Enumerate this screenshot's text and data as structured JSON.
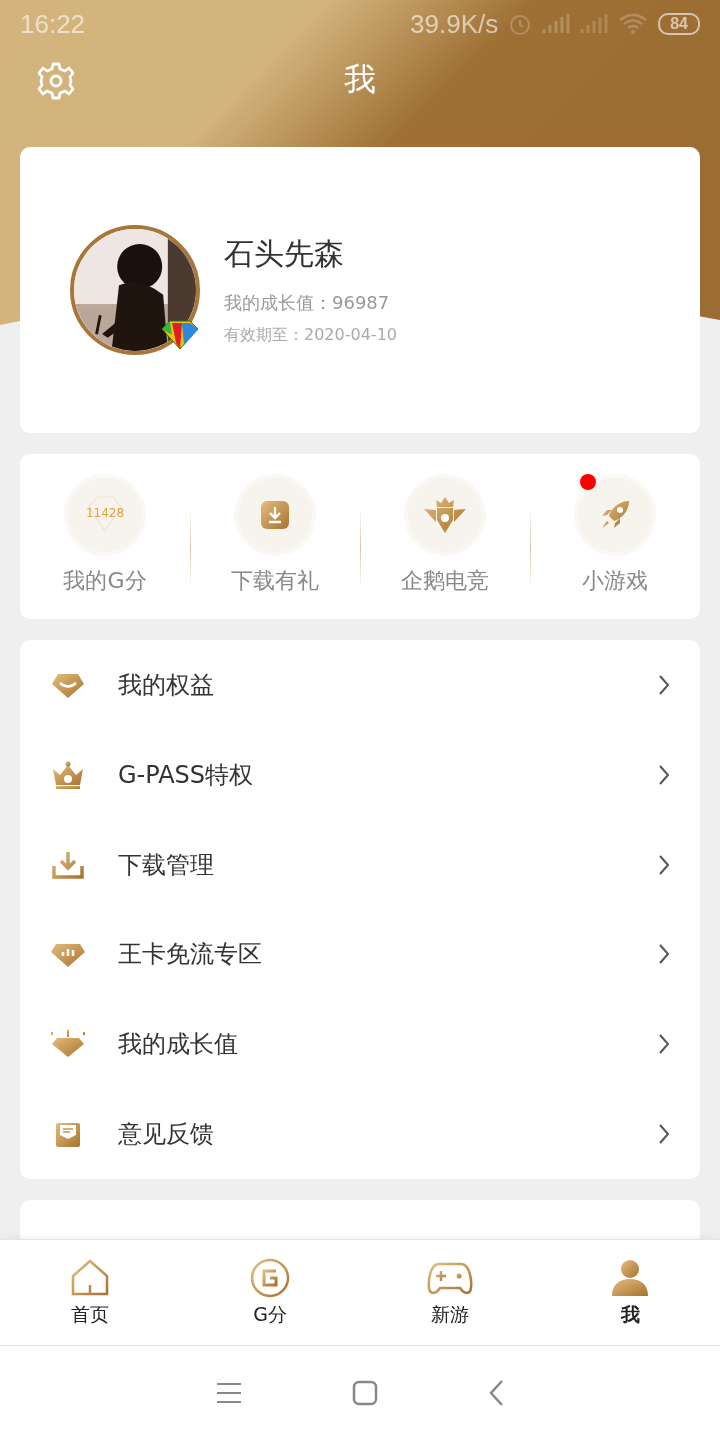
{
  "status_bar": {
    "time": "16:22",
    "speed": "39.9K/s",
    "battery": "84"
  },
  "header": {
    "title": "我"
  },
  "profile": {
    "name": "石头先森",
    "growth": "我的成长值：96987",
    "expiry": "有效期至：2020-04-10"
  },
  "shortcuts": [
    {
      "kind": "diamond",
      "label": "我的G分",
      "value": "11428",
      "badge": false
    },
    {
      "kind": "gift",
      "label": "下载有礼",
      "badge": false
    },
    {
      "kind": "esports",
      "label": "企鹅电竞",
      "badge": false
    },
    {
      "kind": "rocket",
      "label": "小游戏",
      "badge": true
    }
  ],
  "menu": [
    {
      "kind": "rights",
      "label": "我的权益"
    },
    {
      "kind": "crown",
      "label": "G-PASS特权"
    },
    {
      "kind": "download",
      "label": "下载管理"
    },
    {
      "kind": "card",
      "label": "王卡免流专区"
    },
    {
      "kind": "growth",
      "label": "我的成长值"
    },
    {
      "kind": "feedback",
      "label": "意见反馈"
    }
  ],
  "tabs": [
    {
      "kind": "home",
      "label": "首页",
      "selected": false
    },
    {
      "kind": "gscore",
      "label": "G分",
      "selected": false
    },
    {
      "kind": "games",
      "label": "新游",
      "selected": false
    },
    {
      "kind": "me",
      "label": "我",
      "selected": true
    }
  ]
}
